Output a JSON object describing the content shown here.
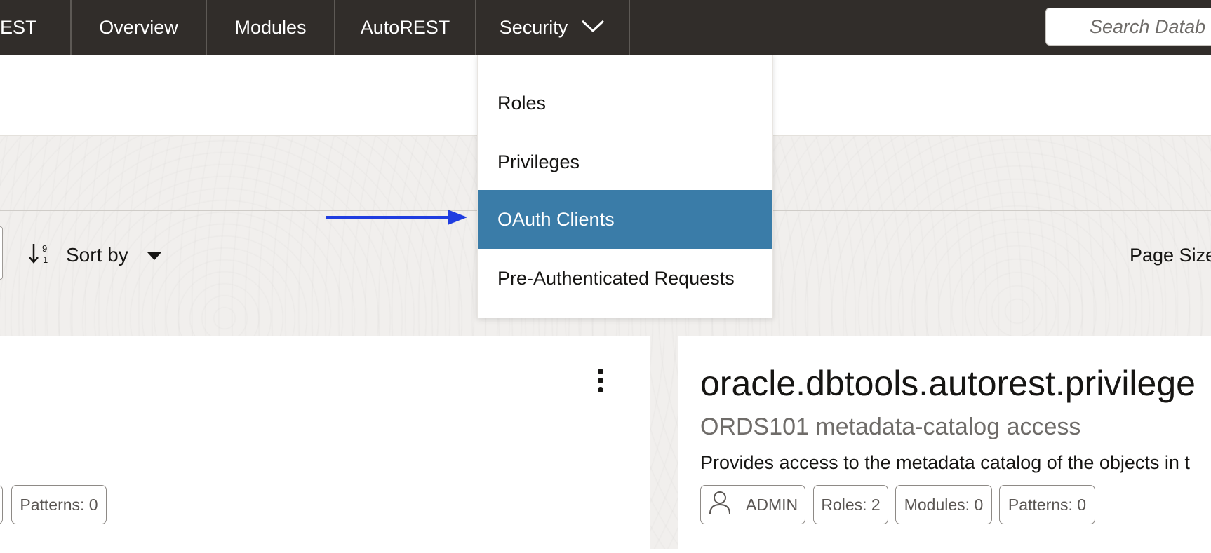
{
  "nav": {
    "partial_label": "EST",
    "items": [
      {
        "label": "Overview"
      },
      {
        "label": "Modules"
      },
      {
        "label": "AutoREST"
      },
      {
        "label": "Security"
      }
    ]
  },
  "search": {
    "placeholder": "Search Datab"
  },
  "toolbar": {
    "sort_label": "Sort by",
    "page_size_label": "Page Size"
  },
  "security_menu": {
    "items": [
      {
        "label": "Roles"
      },
      {
        "label": "Privileges"
      },
      {
        "label": "OAuth Clients",
        "highlighted": true
      },
      {
        "label": "Pre-Authenticated Requests"
      }
    ]
  },
  "cards": {
    "left": {
      "patterns_chip": "Patterns: 0"
    },
    "right": {
      "title": "oracle.dbtools.autorest.privilege",
      "subtitle": "ORDS101 metadata-catalog access",
      "description": "Provides access to the metadata catalog of the objects in t",
      "chips": {
        "owner": "ADMIN",
        "roles": "Roles: 2",
        "modules": "Modules: 0",
        "patterns": "Patterns: 0"
      }
    }
  },
  "colors": {
    "nav_bg": "#312d2a",
    "highlight": "#3a7ca8",
    "annotation_arrow": "#1f3de0"
  }
}
